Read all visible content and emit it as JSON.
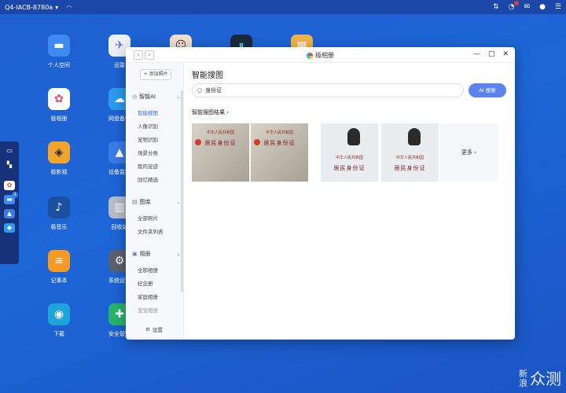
{
  "topbar": {
    "device": "Q4-IACB-8780a",
    "dropdown": "▾",
    "icons": [
      "wifi-icon",
      "transfer-icon",
      "speed-icon",
      "message-icon",
      "user-icon",
      "menu-icon"
    ]
  },
  "desktop": {
    "apps": [
      {
        "label": "个人空间",
        "color": "#3d8bf0",
        "glyph": "▬",
        "icon": "folder-icon"
      },
      {
        "label": "极相册",
        "color": "#ffffff",
        "glyph": "✿",
        "icon": "photos-icon"
      },
      {
        "label": "极影视",
        "color": "#f2a52d",
        "glyph": "◈",
        "icon": "video-icon"
      },
      {
        "label": "极音乐",
        "color": "#1c4fa0",
        "glyph": "♪",
        "icon": "music-icon"
      },
      {
        "label": "记事本",
        "color": "#f49a25",
        "glyph": "≡",
        "icon": "notes-icon"
      },
      {
        "label": "下载",
        "color": "#1ea4d9",
        "glyph": "◉",
        "icon": "download-icon"
      },
      {
        "label": "迅雷",
        "color": "#eef1f8",
        "glyph": "✈",
        "icon": "xunlei-icon"
      },
      {
        "label": "网盘备份",
        "color": "#2b9bf0",
        "glyph": "☁",
        "icon": "backup-icon"
      },
      {
        "label": "设备监控",
        "color": "#3a7ce8",
        "glyph": "▲",
        "icon": "monitor-icon"
      },
      {
        "label": "回收站",
        "color": "#b8bec8",
        "glyph": "▥",
        "icon": "trash-icon"
      },
      {
        "label": "系统设置",
        "color": "#5a6270",
        "glyph": "⚙",
        "icon": "settings-icon"
      },
      {
        "label": "安全管家",
        "color": "#27b46e",
        "glyph": "✚",
        "icon": "security-icon"
      }
    ],
    "top_row": [
      {
        "color": "#f3e0cf",
        "glyph": "☺",
        "icon": "avatar-app-icon"
      },
      {
        "color": "#1b2a3a",
        "glyph": "⏸",
        "icon": "audio-app-icon"
      },
      {
        "color": "#f0b24a",
        "glyph": "▦",
        "icon": "grid-app-icon"
      }
    ]
  },
  "dock": {
    "items": [
      "apps-icon",
      "grid-icon",
      "photos-icon",
      "folder-icon",
      "monitor-icon",
      "docker-icon"
    ],
    "badge": "2"
  },
  "window": {
    "title": "极相册",
    "controls": [
      "—",
      "□",
      "✕"
    ],
    "nav": [
      "‹",
      "›"
    ],
    "sidebar": {
      "add_photo": "+ 添加照片",
      "groups": [
        {
          "label": "智能AI",
          "icon": "ai-icon",
          "items": [
            "智能搜图",
            "人像识别",
            "宠物识别",
            "场景分类",
            "我的足迹",
            "回忆精选"
          ]
        },
        {
          "label": "图库",
          "icon": "gallery-icon",
          "items": [
            "全部照片",
            "文件夹列表"
          ]
        },
        {
          "label": "相册",
          "icon": "album-icon",
          "items": [
            "全部相册",
            "纪念册",
            "家庭相册",
            "宝宝相册"
          ]
        }
      ],
      "active_item": "智能搜图",
      "settings": "设置"
    },
    "main": {
      "title": "智能搜图",
      "search_value": "身份证",
      "ai_button": "AI 搜索",
      "results_title": "智能搜图结果",
      "results_chevron": "›",
      "more": "更多 ›",
      "card_text": "中华人民共和国",
      "card_title": "居民身份证"
    }
  },
  "watermark": {
    "line1": "新",
    "line2": "浪",
    "brand": "众测"
  }
}
